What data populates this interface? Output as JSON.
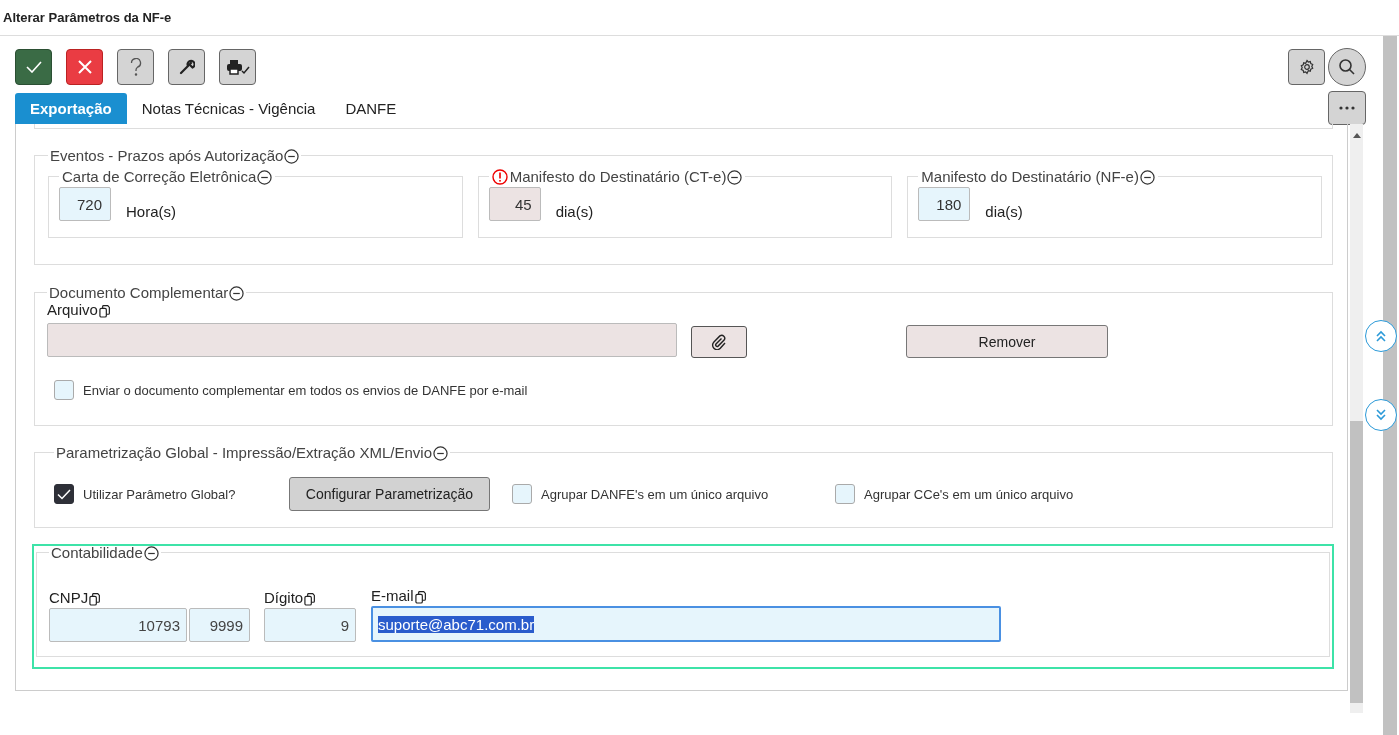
{
  "window": {
    "title": "Alterar Parâmetros da NF-e"
  },
  "toolbar": {
    "left": [
      {
        "kind": "confirm"
      },
      {
        "kind": "cancel"
      },
      {
        "kind": "help"
      },
      {
        "kind": "tools"
      },
      {
        "kind": "print"
      }
    ],
    "right": [
      {
        "kind": "settings"
      },
      {
        "kind": "search"
      }
    ]
  },
  "tabs": [
    {
      "label": "Exportação",
      "selected": true
    },
    {
      "label": "Notas Técnicas - Vigência",
      "selected": false
    },
    {
      "label": "DANFE",
      "selected": false
    }
  ],
  "eventos": {
    "legend": "Eventos - Prazos após Autorização",
    "groups": [
      {
        "legend": "Carta de Correção Eletrônica",
        "warning": false,
        "value": "720",
        "unit": "Hora(s)",
        "disabled": false
      },
      {
        "legend": "Manifesto do Destinatário (CT-e)",
        "warning": true,
        "value": "45",
        "unit": "dia(s)",
        "disabled": true
      },
      {
        "legend": "Manifesto do Destinatário (NF-e)",
        "warning": false,
        "value": "180",
        "unit": "dia(s)",
        "disabled": false
      }
    ]
  },
  "documento": {
    "legend": "Documento Complementar",
    "file_label": "Arquivo",
    "remove_button": "Remover",
    "checkbox": {
      "label": "Enviar o documento complementar em todos os envios de DANFE por e-mail",
      "checked": false
    }
  },
  "global": {
    "legend": "Parametrização Global - Impressão/Extração XML/Envio",
    "use_global": {
      "label": "Utilizar Parâmetro Global?",
      "checked": true
    },
    "button": "Configurar Parametrização",
    "checkboxes": [
      {
        "label": "Agrupar DANFE's em um único arquivo",
        "checked": false
      },
      {
        "label": "Agrupar CCe's em um único arquivo",
        "checked": false
      }
    ]
  },
  "contabilidade": {
    "legend": "Contabilidade",
    "focused": true,
    "cnpj": {
      "label": "CNPJ",
      "values": [
        "10793",
        "9999"
      ]
    },
    "digito": {
      "label": "Dígito",
      "value": "9"
    },
    "email": {
      "label": "E-mail",
      "value": "suporte@abc71.com.br",
      "text_highlighted": true
    }
  }
}
